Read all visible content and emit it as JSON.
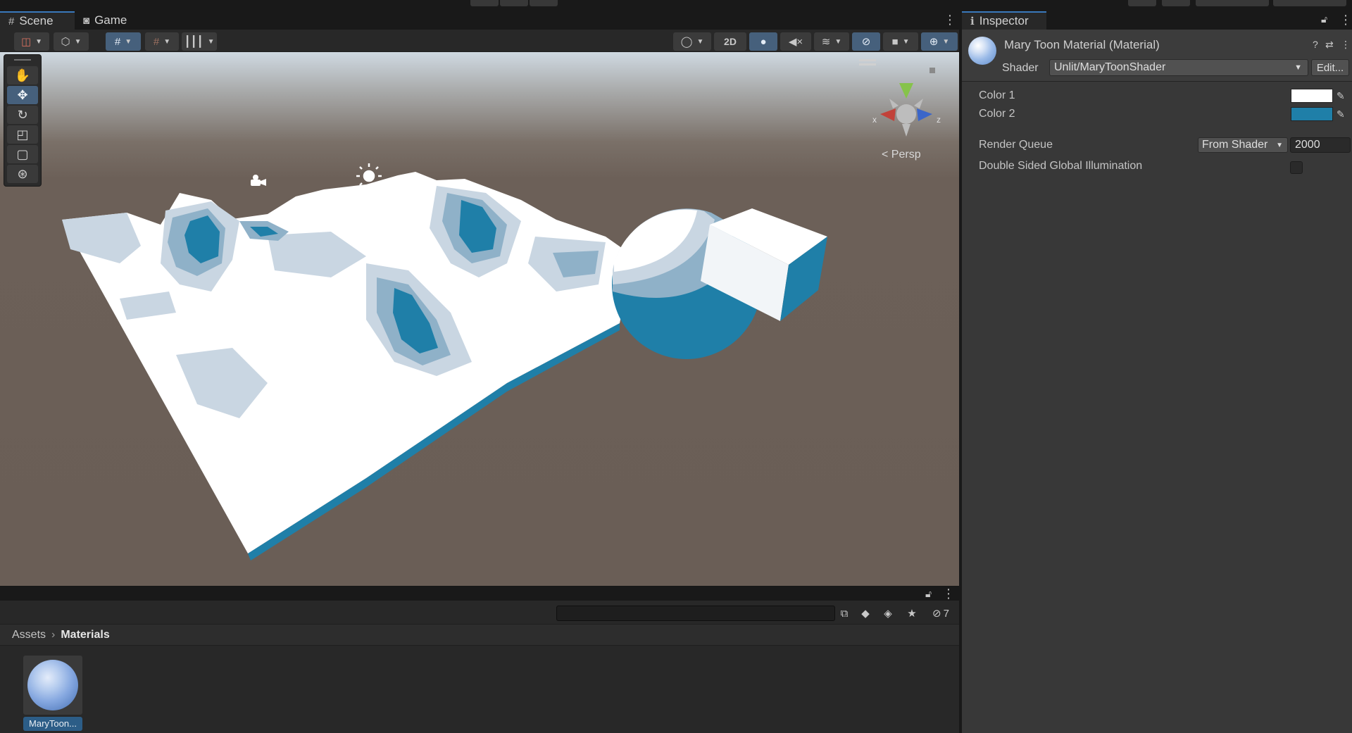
{
  "scene": {
    "tabs": [
      {
        "label": "Scene",
        "icon": "grid-hash-icon"
      },
      {
        "label": "Game",
        "icon": "gamepad-icon"
      }
    ],
    "toolbar": {
      "twod_label": "2D"
    },
    "viewport": {
      "camera_mode": "Persp",
      "gizmo_axes": [
        "x",
        "z"
      ]
    }
  },
  "project": {
    "breadcrumb": [
      "Assets",
      "Materials"
    ],
    "hidden_count": "7",
    "search": {
      "value": "",
      "placeholder": ""
    },
    "assets": [
      {
        "label": "MaryToon..."
      }
    ]
  },
  "inspector": {
    "tab_label": "Inspector",
    "material_title": "Mary Toon Material (Material)",
    "shader_label": "Shader",
    "shader_value": "Unlit/MaryToonShader",
    "edit_label": "Edit...",
    "properties": {
      "color1_label": "Color 1",
      "color1_value": "#ffffff",
      "color2_label": "Color 2",
      "color2_value": "#1f7fa8",
      "render_queue_label": "Render Queue",
      "render_queue_mode": "From Shader",
      "render_queue_value": "2000",
      "dsgi_label": "Double Sided Global Illumination",
      "dsgi_checked": false
    }
  },
  "colors": {
    "accent": "#3a79bb",
    "toon_blue": "#1f7fa8",
    "selection": "#2c5d87"
  }
}
